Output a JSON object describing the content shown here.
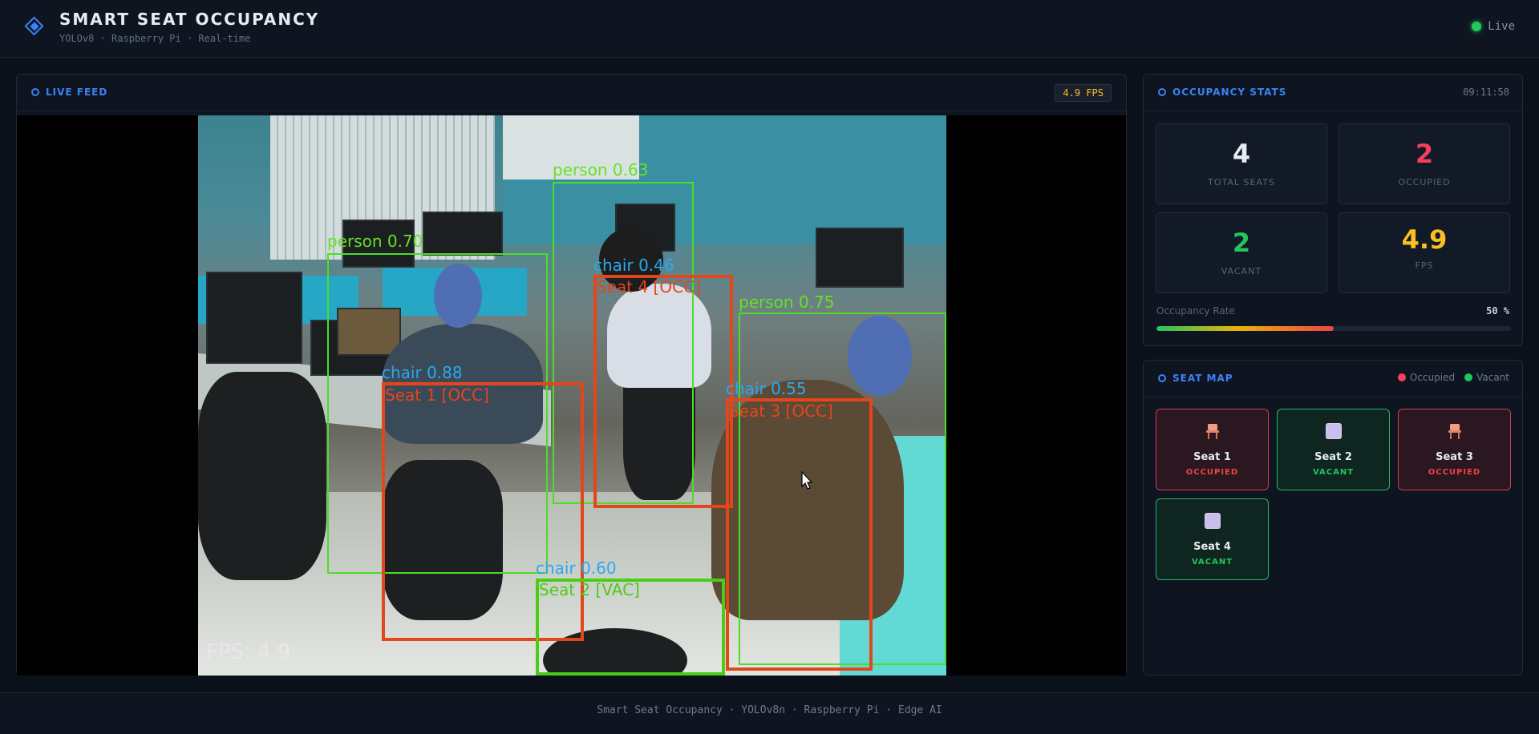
{
  "header": {
    "title": "SMART SEAT OCCUPANCY",
    "subtitle": "YOLOv8 · Raspberry Pi · Real-time",
    "live_label": "Live"
  },
  "feed": {
    "title": "LIVE FEED",
    "fps_badge": "4.9 FPS",
    "fps_overlay": "FPS: 4.9",
    "detections": [
      {
        "label": "person 0.63",
        "kind": "person"
      },
      {
        "label": "person 0.70",
        "kind": "person"
      },
      {
        "label": "person 0.75",
        "kind": "person"
      },
      {
        "label": "chair 0.46",
        "kind": "chair"
      },
      {
        "label": "Seat 4 [OCC]",
        "kind": "seat-occ"
      },
      {
        "label": "chair 0.88",
        "kind": "chair"
      },
      {
        "label": "Seat 1 [OCC]",
        "kind": "seat-occ"
      },
      {
        "label": "chair 0.55",
        "kind": "chair"
      },
      {
        "label": "Seat 3 [OCC]",
        "kind": "seat-occ"
      },
      {
        "label": "chair 0.60",
        "kind": "chair"
      },
      {
        "label": "Seat 2 [VAC]",
        "kind": "seat-vac"
      }
    ]
  },
  "stats": {
    "title": "OCCUPANCY STATS",
    "clock": "09:11:58",
    "cards": [
      {
        "value": "4",
        "label": "TOTAL SEATS",
        "color": "#e6ecf5"
      },
      {
        "value": "2",
        "label": "OCCUPIED",
        "color": "#f43f5e"
      },
      {
        "value": "2",
        "label": "VACANT",
        "color": "#22c55e"
      },
      {
        "value": "4.9",
        "label": "FPS",
        "color": "#fbbf24"
      }
    ],
    "rate_label": "Occupancy Rate",
    "rate_value": "50 %",
    "rate_fraction": 0.5
  },
  "seat_map": {
    "title": "SEAT MAP",
    "legend": {
      "occupied": "Occupied",
      "vacant": "Vacant"
    },
    "colors": {
      "occupied": "#ef4444",
      "vacant": "#22c55e"
    },
    "seats": [
      {
        "name": "Seat 1",
        "status": "OCCUPIED",
        "icon": "chair-icon"
      },
      {
        "name": "Seat 2",
        "status": "VACANT",
        "icon": "empty-seat-icon"
      },
      {
        "name": "Seat 3",
        "status": "OCCUPIED",
        "icon": "chair-icon"
      },
      {
        "name": "Seat 4",
        "status": "VACANT",
        "icon": "empty-seat-icon"
      }
    ]
  },
  "footer": {
    "text": "Smart Seat Occupancy · YOLOv8n · Raspberry Pi · Edge AI"
  }
}
